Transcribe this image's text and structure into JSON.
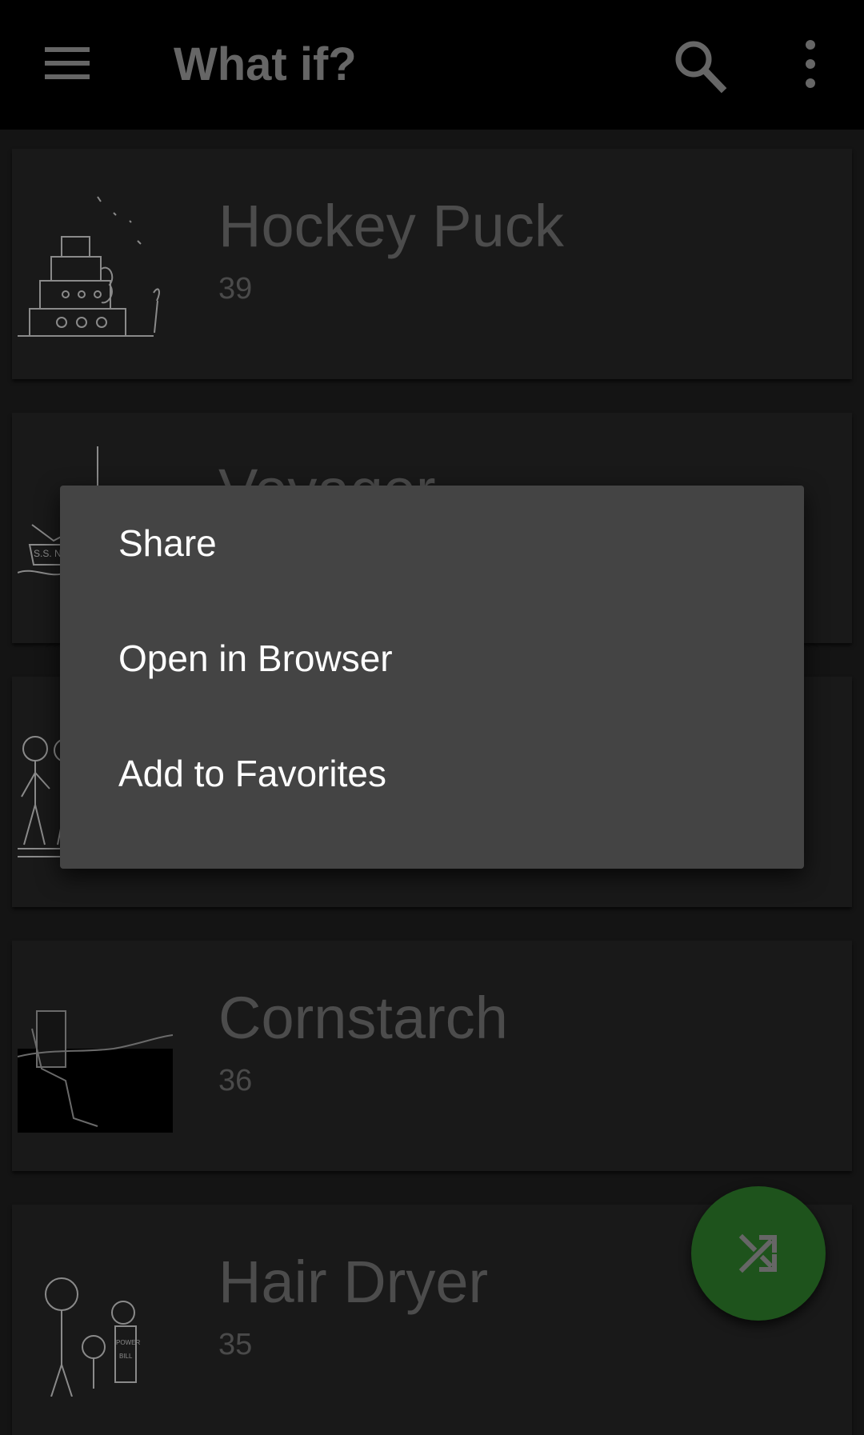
{
  "app_bar": {
    "title": "What if?",
    "icons": {
      "menu": "hamburger-menu-icon",
      "search": "search-icon",
      "more": "more-vert-icon"
    },
    "colors": {
      "background": "#000000",
      "icon": "#666666"
    }
  },
  "articles": [
    {
      "title": "Hockey Puck",
      "number": "39",
      "thumbnail": "wedding-cake-drawing"
    },
    {
      "title": "Voyager",
      "number": "",
      "thumbnail": "ship-drawing"
    },
    {
      "title": "",
      "number": "",
      "thumbnail": "stick-figures-drawing"
    },
    {
      "title": "Cornstarch",
      "number": "36",
      "thumbnail": "toilet-hill-drawing"
    },
    {
      "title": "Hair Dryer",
      "number": "35",
      "thumbnail": "stick-figures-power-bill-drawing"
    }
  ],
  "context_menu": {
    "items": [
      {
        "label": "Share"
      },
      {
        "label": "Open in Browser"
      },
      {
        "label": "Add to Favorites"
      }
    ],
    "colors": {
      "background": "#444444",
      "text": "#ffffff"
    }
  },
  "fab": {
    "icon": "shuffle-icon",
    "color": "#1e531c"
  }
}
